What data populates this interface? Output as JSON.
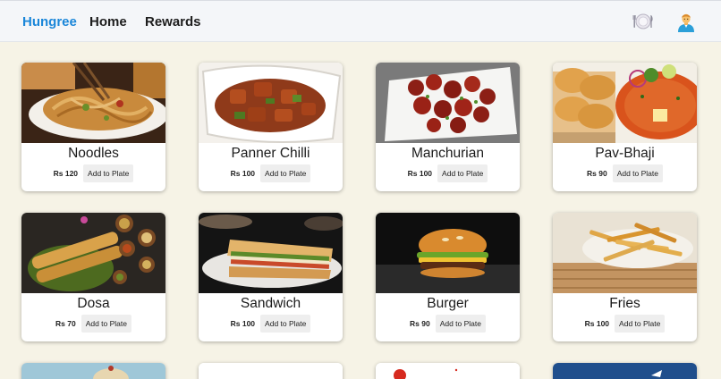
{
  "nav": {
    "brand": "Hungree",
    "links": [
      "Home",
      "Rewards"
    ],
    "icons": [
      "plate-cutlery-icon",
      "user-avatar-icon"
    ]
  },
  "menu": {
    "items": [
      {
        "name": "Noodles",
        "price": "Rs 120",
        "action": "Add to Plate"
      },
      {
        "name": "Panner Chilli",
        "price": "Rs 100",
        "action": "Add to Plate"
      },
      {
        "name": "Manchurian",
        "price": "Rs 100",
        "action": "Add to Plate"
      },
      {
        "name": "Pav-Bhaji",
        "price": "Rs 90",
        "action": "Add to Plate"
      },
      {
        "name": "Dosa",
        "price": "Rs 70",
        "action": "Add to Plate"
      },
      {
        "name": "Sandwich",
        "price": "Rs 100",
        "action": "Add to Plate"
      },
      {
        "name": "Burger",
        "price": "Rs 90",
        "action": "Add to Plate"
      },
      {
        "name": "Fries",
        "price": "Rs 100",
        "action": "Add to Plate"
      }
    ]
  },
  "colors": {
    "page_bg": "#f6f3e6",
    "brand": "#1a86d9",
    "navbar_bg": "#f4f6f9"
  }
}
